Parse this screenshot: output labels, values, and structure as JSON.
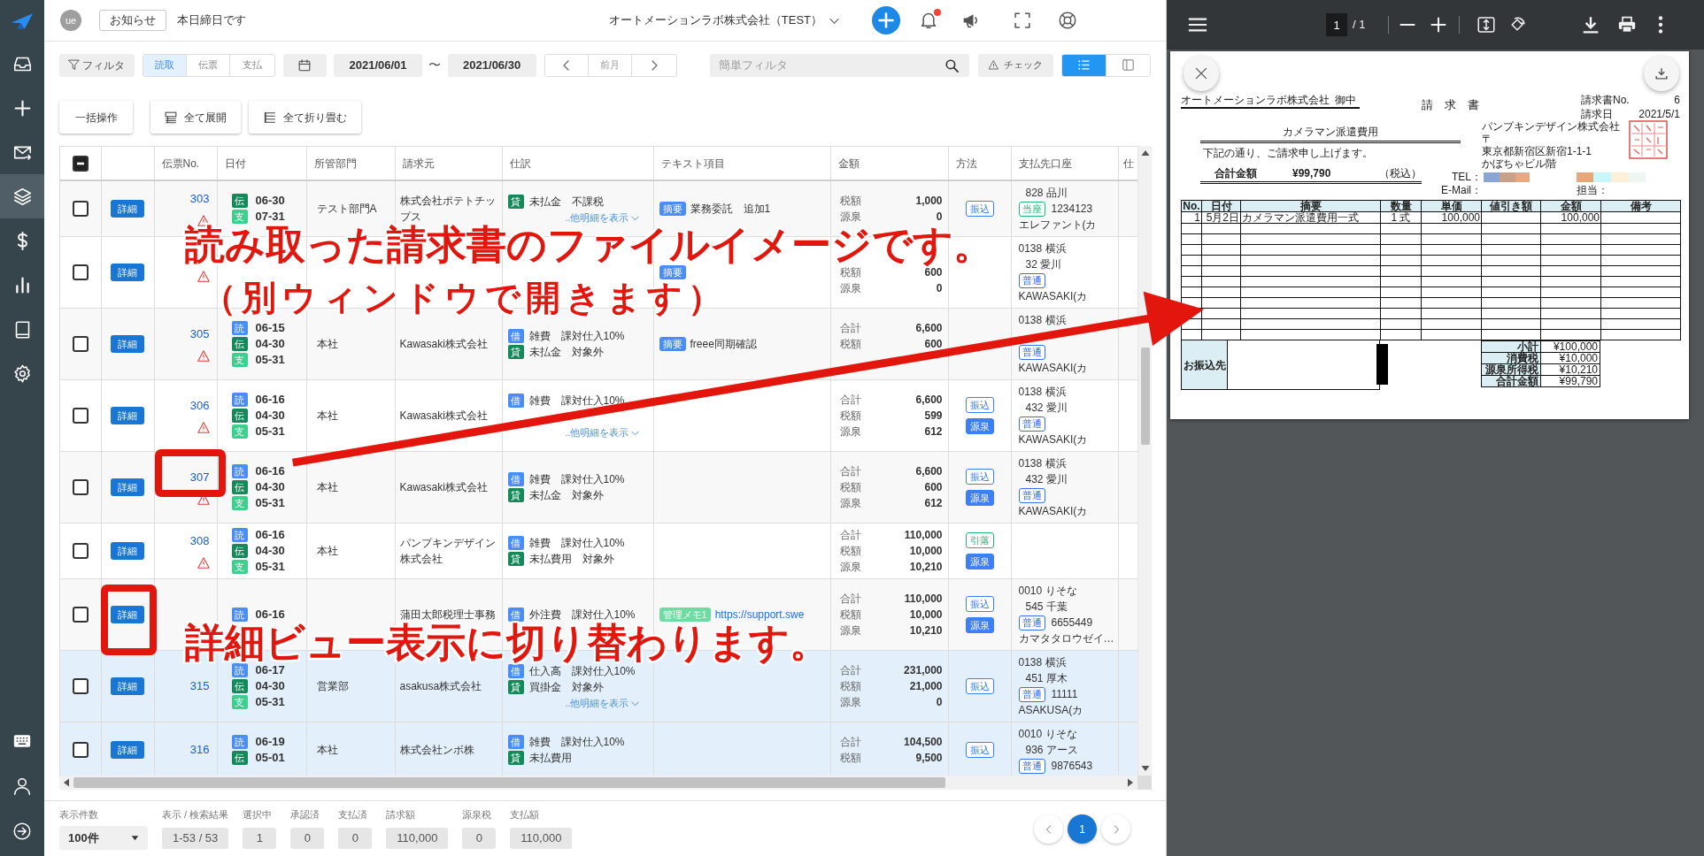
{
  "sidebar": {
    "items": [
      {
        "selected": false
      },
      {
        "selected": false
      },
      {
        "selected": false
      },
      {
        "selected": true
      },
      {
        "selected": false
      },
      {
        "selected": false
      },
      {
        "selected": false
      },
      {
        "selected": false
      }
    ]
  },
  "header": {
    "avatar": "ue",
    "notice_button": "お知らせ",
    "message": "本日締日です",
    "company": "オートメーションラボ株式会社（TEST）",
    "unread": true
  },
  "toolbar": {
    "filter_button": "フィルタ",
    "segments": [
      {
        "label": "読取",
        "selected": true
      },
      {
        "label": "伝票",
        "selected": false
      },
      {
        "label": "支払",
        "selected": false
      }
    ],
    "date_from": "2021/06/01",
    "date_separator": "〜",
    "date_to": "2021/06/30",
    "month_button": "前月",
    "search": {
      "placeholder": "簡単フィルタ"
    },
    "check_button": "チェック",
    "views": [
      {
        "selected": true
      },
      {
        "selected": false
      }
    ]
  },
  "actions": [
    {
      "label": "一括操作",
      "kind": "plain"
    },
    {
      "label": "全て展開",
      "kind": "expand"
    },
    {
      "label": "全て折り畳む",
      "kind": "collapse"
    }
  ],
  "table": {
    "select_all": {
      "indeterminate": true
    },
    "columns": [
      "伝票No.",
      "日付",
      "所管部門",
      "請求元",
      "仕訳",
      "テキスト項目",
      "金額",
      "方法",
      "支払先口座",
      "仕"
    ],
    "rows": [
      {
        "checked": false,
        "highlighted": false,
        "number_boxed": false,
        "detail_boxed": false,
        "detail": "詳細",
        "number": "303",
        "warning": true,
        "dates": [
          {
            "tag": "伝",
            "color": "#16895b",
            "date": "06-30"
          },
          {
            "tag": "支",
            "color": "#3dcf8e",
            "date": "07-31"
          }
        ],
        "department": "テスト部門A",
        "vendor": "株式会社ポテトチップス",
        "journal": [
          {
            "tag": "貸",
            "color": "#16895b",
            "text": "未払金　不課税"
          }
        ],
        "more": "..他明細を表示",
        "notes": [
          {
            "kind": "text",
            "tag": "摘要",
            "color": "#4a8df6",
            "text": "業務委託　追加1"
          }
        ],
        "amounts": [
          {
            "label": "税額",
            "value": "1,000"
          },
          {
            "label": "源泉",
            "value": "0"
          }
        ],
        "methods": [
          {
            "kind": "outline",
            "label": "振込",
            "color": "#3d7ff5"
          }
        ],
        "account": {
          "branch": "828 品川",
          "type": {
            "label": "当座",
            "color": "#25b576"
          },
          "number": "1234123",
          "holder": "エレファント(カ"
        }
      },
      {
        "checked": false,
        "highlighted": false,
        "detail_boxed": false,
        "detail": "詳細",
        "warning": true,
        "notes": [
          {
            "tag": "摘要",
            "color": "#4a8df6"
          }
        ],
        "amounts": [
          {
            "covered": true
          },
          {
            "label": "税額",
            "value": "600"
          },
          {
            "label": "源泉",
            "value": "0"
          }
        ],
        "account": {
          "bank": "0138 横浜",
          "branch": "32 愛川",
          "type": {
            "label": "普通",
            "color": "#3d6fe8"
          },
          "holder": "KAWASAKI(カ"
        }
      },
      {
        "checked": false,
        "highlighted": false,
        "number_boxed": false,
        "detail_boxed": false,
        "detail": "詳細",
        "number": "305",
        "warning": true,
        "dates": [
          {
            "tag": "読",
            "color": "#4a8df6",
            "date": "06-15"
          },
          {
            "tag": "伝",
            "color": "#16895b",
            "date": "04-30"
          },
          {
            "tag": "支",
            "color": "#3dcf8e",
            "date": "05-31"
          }
        ],
        "department": "本社",
        "vendor": "Kawasaki株式会社",
        "journal": [
          {
            "tag": "借",
            "color": "#4a8df6",
            "text": "雑費　課対仕入10%"
          },
          {
            "tag": "貸",
            "color": "#16895b",
            "text": "未払金　対象外"
          }
        ],
        "notes": [
          {
            "kind": "text",
            "tag": "摘要",
            "color": "#4a8df6",
            "text": "freee同期確認"
          }
        ],
        "amounts": [
          {
            "label": "合計",
            "value": "6,600"
          },
          {
            "label": "税額",
            "value": "600"
          },
          {
            "covered": true
          }
        ],
        "account": {
          "bank": "0138 横浜",
          "branch_covered": true,
          "type": {
            "label": "普通",
            "color": "#3d6fe8"
          },
          "holder": "KAWASAKI(カ"
        }
      },
      {
        "checked": false,
        "highlighted": false,
        "number_boxed": false,
        "detail_boxed": false,
        "detail": "詳細",
        "number": "306",
        "warning": true,
        "dates": [
          {
            "tag": "読",
            "color": "#4a8df6",
            "date": "06-16"
          },
          {
            "tag": "伝",
            "color": "#16895b",
            "date": "04-30"
          },
          {
            "tag": "支",
            "color": "#3dcf8e",
            "date": "05-31"
          }
        ],
        "department": "本社",
        "vendor": "Kawasaki株式会社",
        "journal": [
          {
            "tag": "借",
            "color": "#4a8df6",
            "text": "雑費　課対仕入10%"
          },
          {
            "covered": true
          }
        ],
        "more": "..他明細を表示",
        "amounts": [
          {
            "label": "合計",
            "value": "6,600"
          },
          {
            "label": "税額",
            "value": "599"
          },
          {
            "label": "源泉",
            "value": "612"
          }
        ],
        "methods": [
          {
            "kind": "outline",
            "label": "振込",
            "color": "#3d7ff5"
          },
          {
            "kind": "solid",
            "label": "源泉",
            "color": "#3d7ff5"
          }
        ],
        "account": {
          "bank": "0138 横浜",
          "branch": "432 愛川",
          "type": {
            "label": "普通",
            "color": "#3d6fe8"
          },
          "holder": "KAWASAKI(カ"
        }
      },
      {
        "checked": false,
        "highlighted": false,
        "number_boxed": true,
        "detail_boxed": false,
        "detail": "詳細",
        "number": "307",
        "warning": true,
        "dates": [
          {
            "tag": "読",
            "color": "#4a8df6",
            "date": "06-16"
          },
          {
            "tag": "伝",
            "color": "#16895b",
            "date": "04-30"
          },
          {
            "tag": "支",
            "color": "#3dcf8e",
            "date": "05-31"
          }
        ],
        "department": "本社",
        "vendor": "Kawasaki株式会社",
        "journal": [
          {
            "tag": "借",
            "color": "#4a8df6",
            "text": "雑費　課対仕入10%"
          },
          {
            "tag": "貸",
            "color": "#16895b",
            "text": "未払金　対象外"
          }
        ],
        "amounts": [
          {
            "label": "合計",
            "value": "6,600"
          },
          {
            "label": "税額",
            "value": "600"
          },
          {
            "label": "源泉",
            "value": "612"
          }
        ],
        "methods": [
          {
            "kind": "outline",
            "label": "振込",
            "color": "#3d7ff5"
          },
          {
            "kind": "solid",
            "label": "源泉",
            "color": "#3d7ff5"
          }
        ],
        "account": {
          "bank": "0138 横浜",
          "branch": "432 愛川",
          "type": {
            "label": "普通",
            "color": "#3d6fe8"
          },
          "holder": "KAWASAKI(カ"
        }
      },
      {
        "checked": false,
        "highlighted": false,
        "number_boxed": false,
        "detail_boxed": false,
        "detail": "詳細",
        "number": "308",
        "warning": true,
        "dates": [
          {
            "tag": "読",
            "color": "#4a8df6",
            "date": "06-16"
          },
          {
            "tag": "伝",
            "color": "#16895b",
            "date": "04-30"
          },
          {
            "tag": "支",
            "color": "#3dcf8e",
            "date": "05-31"
          }
        ],
        "department": "本社",
        "vendor": "パンプキンデザイン株式会社",
        "journal": [
          {
            "tag": "借",
            "color": "#4a8df6",
            "text": "雑費　課対仕入10%"
          },
          {
            "tag": "貸",
            "color": "#16895b",
            "text": "未払費用　対象外"
          }
        ],
        "amounts": [
          {
            "label": "合計",
            "value": "110,000"
          },
          {
            "label": "税額",
            "value": "10,000"
          },
          {
            "label": "源泉",
            "value": "10,210"
          }
        ],
        "methods": [
          {
            "kind": "outline",
            "label": "引落",
            "color": "#25b576"
          },
          {
            "kind": "solid",
            "label": "源泉",
            "color": "#3d7ff5"
          }
        ]
      },
      {
        "checked": false,
        "highlighted": false,
        "detail_boxed": true,
        "detail": "詳細",
        "warning": false,
        "dates": [
          {
            "tag": "読",
            "color": "#4a8df6",
            "date": "06-16"
          }
        ],
        "vendor": "蒲田太郎税理士事務",
        "journal": [
          {
            "tag": "借",
            "color": "#4a8df6",
            "text": "外注費　課対仕入10%"
          }
        ],
        "notes": [
          {
            "kind": "link",
            "tag": "管理メモ1",
            "color": "#6edba3",
            "text": "https://support.swe"
          }
        ],
        "amounts": [
          {
            "label": "合計",
            "value": "110,000"
          },
          {
            "label": "税額",
            "value": "10,000"
          },
          {
            "label": "源泉",
            "value": "10,210"
          }
        ],
        "methods": [
          {
            "kind": "outline",
            "label": "振込",
            "color": "#3d7ff5"
          },
          {
            "kind": "solid",
            "label": "源泉",
            "color": "#3d7ff5"
          }
        ],
        "account": {
          "bank": "0010 りそな",
          "branch": "545 千葉",
          "type": {
            "label": "普通",
            "color": "#3d6fe8"
          },
          "number": "6655449",
          "holder": "カマタタロウゼイ…"
        }
      },
      {
        "checked": false,
        "highlighted": true,
        "number_boxed": false,
        "detail_boxed": false,
        "detail": "詳細",
        "number": "315",
        "warning": false,
        "dates": [
          {
            "tag": "読",
            "color": "#4a8df6",
            "date": "06-17"
          },
          {
            "tag": "伝",
            "color": "#16895b",
            "date": "04-30"
          },
          {
            "tag": "支",
            "color": "#3dcf8e",
            "date": "05-31"
          }
        ],
        "department": "営業部",
        "vendor": "asakusa株式会社",
        "journal": [
          {
            "tag": "借",
            "color": "#4a8df6",
            "text": "仕入高　課対仕入10%"
          },
          {
            "tag": "貸",
            "color": "#16895b",
            "text": "買掛金　対象外"
          }
        ],
        "more": "..他明細を表示",
        "amounts": [
          {
            "label": "合計",
            "value": "231,000"
          },
          {
            "label": "税額",
            "value": "21,000"
          },
          {
            "label": "源泉",
            "value": "0"
          }
        ],
        "methods": [
          {
            "kind": "outline",
            "label": "振込",
            "color": "#3d7ff5"
          }
        ],
        "account": {
          "bank": "0138 横浜",
          "branch": "451 厚木",
          "type": {
            "label": "普通",
            "color": "#3d6fe8"
          },
          "number": "11111",
          "holder": "ASAKUSA(カ"
        }
      },
      {
        "checked": false,
        "highlighted": true,
        "number_boxed": false,
        "detail_boxed": false,
        "detail": "詳細",
        "number": "316",
        "warning": false,
        "dates": [
          {
            "tag": "読",
            "color": "#4a8df6",
            "date": "06-19"
          },
          {
            "tag": "伝",
            "color": "#16895b",
            "date": "05-01"
          }
        ],
        "department": "本社",
        "vendor": "株式会社ンボ株",
        "journal": [
          {
            "tag": "借",
            "color": "#4a8df6",
            "text": "雑費　課対仕入10%"
          },
          {
            "tag": "貸",
            "color": "#16895b",
            "text": "未払費用"
          }
        ],
        "amounts": [
          {
            "label": "合計",
            "value": "104,500"
          },
          {
            "label": "税額",
            "value": "9,500"
          }
        ],
        "methods": [
          {
            "kind": "outline",
            "label": "振込",
            "color": "#3d7ff5"
          }
        ],
        "account": {
          "bank": "0010 りそな",
          "branch": "936 アース",
          "type": {
            "label": "普通",
            "color": "#3d6fe8"
          },
          "number": "9876543"
        }
      }
    ]
  },
  "footer": {
    "page_size_label": "表示件数",
    "page_size": "100件",
    "stats": [
      {
        "label": "表示 / 検索結果",
        "value": "1-53 / 53"
      },
      {
        "label": "選択中",
        "value": "1"
      },
      {
        "label": "承認済",
        "value": "0"
      },
      {
        "label": "支払済",
        "value": "0"
      },
      {
        "label": "請求額",
        "value": "110,000"
      },
      {
        "label": "源泉税",
        "value": "0"
      },
      {
        "label": "支払額",
        "value": "110,000"
      }
    ],
    "pages": [
      {
        "label": "1",
        "selected": true
      }
    ]
  },
  "viewer": {
    "page": "1",
    "page_total": "/ 1",
    "document": {
      "recipient": "オートメーションラボ株式会社",
      "honorific": "御中",
      "title": "請　求　書",
      "meta": [
        {
          "label": "請求書No.",
          "value": "6"
        },
        {
          "label": "請求日",
          "value": "2021/5/1"
        }
      ],
      "subject": "カメラマン派遣費用",
      "message": "下記の通り、ご請求申し上げます。",
      "total_label": "合計金額",
      "total": "¥99,790",
      "tax_note": "（税込）",
      "issuer": [
        "パンプキンデザイン株式会社",
        "〒",
        "東京都新宿区新宿1-1-1",
        "かぼちゃビル階"
      ],
      "tel_label": "TEL：",
      "email_label": "E-Mail：",
      "staff_label": "担当：",
      "columns": [
        "No.",
        "日付",
        "摘要",
        "数量",
        "単価",
        "値引き額",
        "金額",
        "備考"
      ],
      "items": [
        {
          "no": "1",
          "date": "5月2日",
          "description": "カメラマン派遣費用一式",
          "quantity": "1 式",
          "unit_price": "100,000",
          "amount": "100,000"
        }
      ],
      "bank_label": "お振込先",
      "totals": [
        {
          "label": "小計",
          "value": "¥100,000"
        },
        {
          "label": "消費税",
          "value": "¥10,000"
        },
        {
          "label": "源泉所得税",
          "value": "¥10,210"
        },
        {
          "label": "合計金額",
          "value": "¥99,790"
        }
      ]
    }
  },
  "annotations": {
    "callouts": [
      "読み取った請求書のファイルイメージです。",
      "（別ウィンドウで開きます）",
      "詳細ビュー表示に切り替わります。"
    ]
  }
}
